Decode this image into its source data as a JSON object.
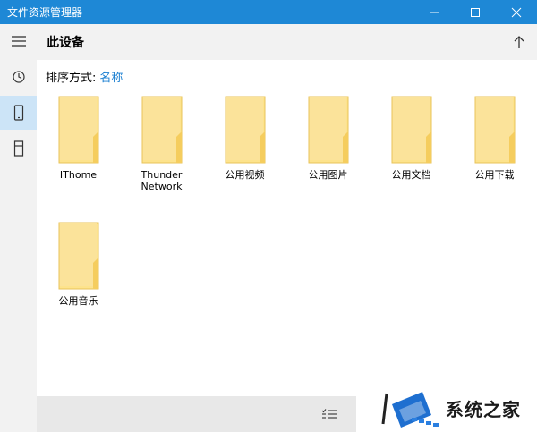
{
  "window": {
    "title": "文件资源管理器"
  },
  "header": {
    "breadcrumb": "此设备"
  },
  "sort": {
    "label": "排序方式:",
    "value": "名称"
  },
  "folders": [
    {
      "name": "IThome"
    },
    {
      "name": "Thunder Network"
    },
    {
      "name": "公用视频"
    },
    {
      "name": "公用图片"
    },
    {
      "name": "公用文档"
    },
    {
      "name": "公用下载"
    },
    {
      "name": "公用音乐"
    }
  ],
  "watermark": {
    "text": "系统之家"
  },
  "colors": {
    "titlebar": "#1e88d6",
    "accent": "#1a7fd1",
    "folder_fill": "#fde38c",
    "folder_edge": "#e8c35a"
  }
}
